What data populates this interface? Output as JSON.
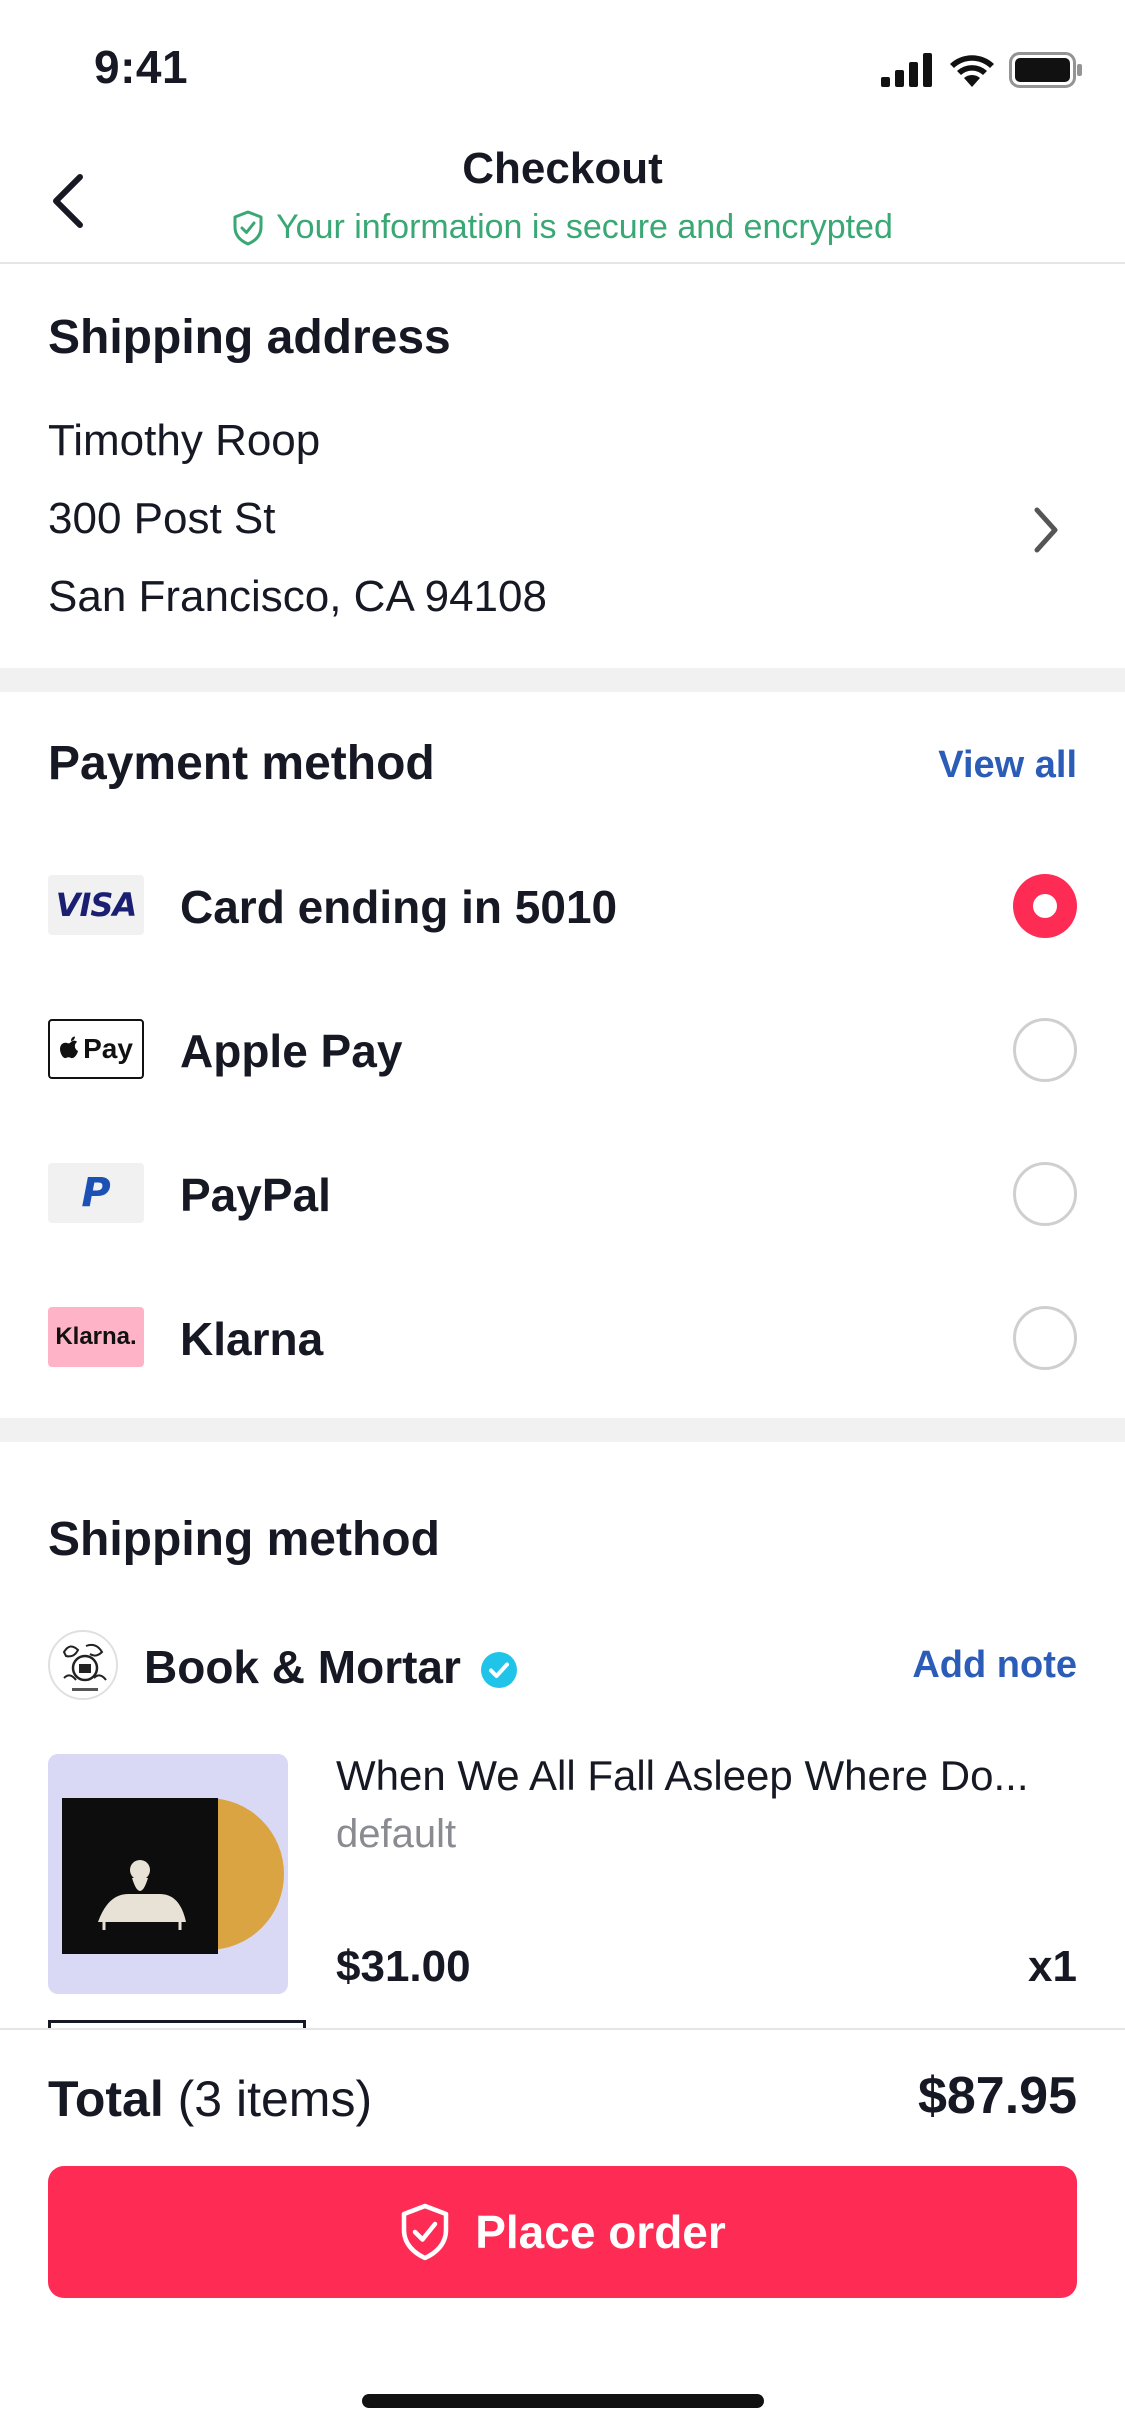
{
  "status_bar": {
    "time": "9:41"
  },
  "header": {
    "title": "Checkout",
    "secure_text": "Your information is secure and encrypted"
  },
  "shipping_address": {
    "title": "Shipping address",
    "name": "Timothy Roop",
    "street": "300 Post St",
    "city_line": "San Francisco, CA 94108"
  },
  "payment": {
    "title": "Payment method",
    "view_all": "View all",
    "options": [
      {
        "label": "Card ending in 5010",
        "logo_text": "VISA",
        "selected": true
      },
      {
        "label": "Apple Pay",
        "logo_text": "Pay",
        "selected": false
      },
      {
        "label": "PayPal",
        "logo_text": "P",
        "selected": false
      },
      {
        "label": "Klarna",
        "logo_text": "Klarna.",
        "selected": false
      }
    ]
  },
  "shipping_method": {
    "title": "Shipping method",
    "seller": {
      "name": "Book & Mortar",
      "verified": true
    },
    "add_note": "Add note",
    "product": {
      "title": "When We All Fall Asleep Where Do...",
      "variant": "default",
      "price": "$31.00",
      "quantity": "x1"
    }
  },
  "summary": {
    "total_label": "Total",
    "items_label": "(3 items)",
    "total_value": "$87.95",
    "place_order": "Place order"
  },
  "colors": {
    "accent": "#fe2c55",
    "link": "#2b5db8",
    "secure_green": "#3aa874",
    "verified_badge": "#20c4e8"
  }
}
